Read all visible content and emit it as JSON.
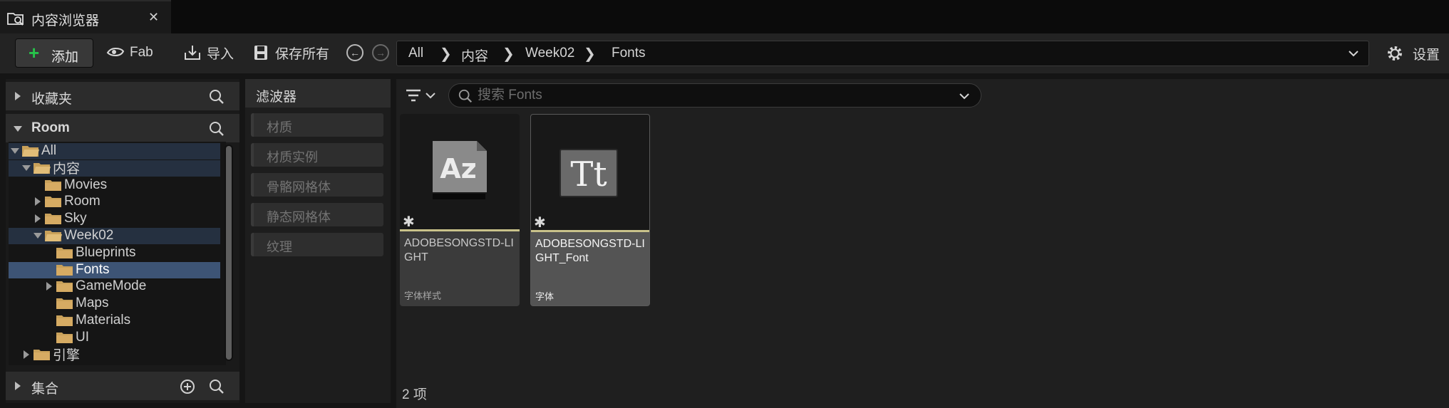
{
  "window": {
    "tab_title": "内容浏览器",
    "close_glyph": "✕"
  },
  "toolbar": {
    "add_label": "添加",
    "fab_label": "Fab",
    "import_label": "导入",
    "save_all_label": "保存所有",
    "settings_label": "设置"
  },
  "breadcrumbs": {
    "items": [
      "All",
      "内容",
      "Week02",
      "Fonts"
    ],
    "separator": "❯"
  },
  "sources": {
    "favorites_title": "收藏夹",
    "room_title": "Room",
    "collections_title": "集合",
    "tree": [
      {
        "label": "All",
        "depth": 0,
        "expanded": true,
        "has_children": true
      },
      {
        "label": "内容",
        "depth": 1,
        "expanded": true,
        "has_children": true
      },
      {
        "label": "Movies",
        "depth": 2,
        "expanded": false,
        "has_children": false
      },
      {
        "label": "Room",
        "depth": 2,
        "expanded": false,
        "has_children": true
      },
      {
        "label": "Sky",
        "depth": 2,
        "expanded": false,
        "has_children": true
      },
      {
        "label": "Week02",
        "depth": 2,
        "expanded": true,
        "has_children": true
      },
      {
        "label": "Blueprints",
        "depth": 3,
        "expanded": false,
        "has_children": false
      },
      {
        "label": "Fonts",
        "depth": 3,
        "expanded": false,
        "has_children": false,
        "selected": true
      },
      {
        "label": "GameMode",
        "depth": 3,
        "expanded": false,
        "has_children": true
      },
      {
        "label": "Maps",
        "depth": 3,
        "expanded": false,
        "has_children": false
      },
      {
        "label": "Materials",
        "depth": 3,
        "expanded": false,
        "has_children": false
      },
      {
        "label": "UI",
        "depth": 3,
        "expanded": false,
        "has_children": false
      },
      {
        "label": "引擎",
        "depth": 1,
        "expanded": false,
        "has_children": true
      }
    ]
  },
  "filters": {
    "title": "滤波器",
    "items": [
      "材质",
      "材质实例",
      "骨骼网格体",
      "静态网格体",
      "纹理"
    ]
  },
  "content": {
    "search_placeholder": "搜索 Fonts",
    "assets": [
      {
        "name": "ADOBESONGSTD-LIGHT",
        "type": "字体样式",
        "icon": "font-face-icon",
        "selected": false,
        "glyph": "Az"
      },
      {
        "name": "ADOBESONGSTD-LIGHT_Font",
        "type": "字体",
        "icon": "font-icon",
        "selected": true,
        "glyph": "Tt"
      }
    ],
    "item_count": "2 项",
    "asterisk": "✱"
  },
  "colors": {
    "add_accent": "#27c34a",
    "selection": "#3d5475",
    "folder": "#c9a15a",
    "asset_underline": "#c9c28a"
  }
}
